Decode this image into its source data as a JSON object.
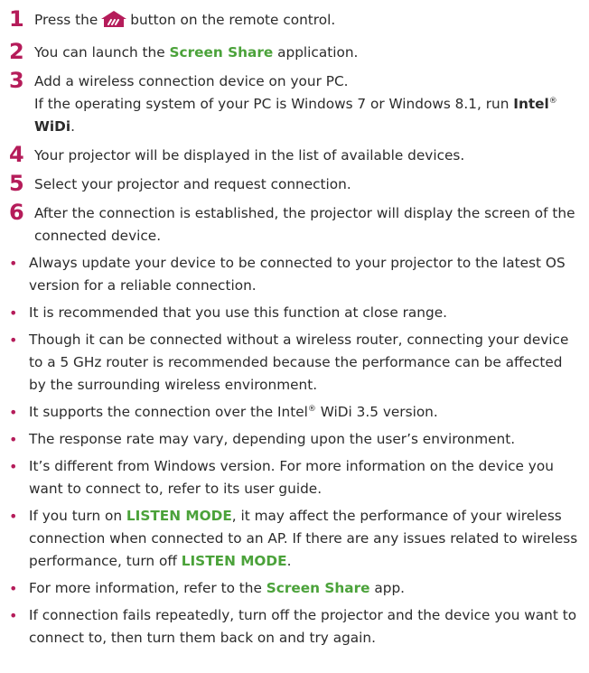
{
  "steps": [
    {
      "num": "1",
      "before": "Press the",
      "icon": "home-icon",
      "after": "button on the remote control."
    },
    {
      "num": "2",
      "before": "You can launch the ",
      "highlight": "Screen Share",
      "after": " application."
    },
    {
      "num": "3",
      "line1": "Add a wireless connection device on your PC.",
      "line2_before": "If the operating system of your PC is Windows 7 or Windows 8.1, run ",
      "bold1": "Intel",
      "sup": "®",
      "bold2": "WiDi",
      "line2_after": "."
    },
    {
      "num": "4",
      "text": "Your projector will be displayed in the list of available devices."
    },
    {
      "num": "5",
      "text": "Select your projector and request connection."
    },
    {
      "num": "6",
      "text": "After the connection is established, the projector will display the screen of the connected device."
    }
  ],
  "bullets": [
    {
      "text": "Always update your device to be connected to your projector to the latest OS version for a reliable connection."
    },
    {
      "text": "It is recommended that you use this function at close range."
    },
    {
      "text": "Though it can be connected without a wireless router, connecting your device to a 5 GHz router is recommended because the performance can be affected by the surrounding wireless environment."
    },
    {
      "before": "It supports the connection over the Intel",
      "sup": "®",
      "after": " WiDi 3.5 version."
    },
    {
      "text": "The response rate may vary, depending upon the user’s environment."
    },
    {
      "text": "It’s different from Windows version. For more information on the device you want to connect to, refer to its user guide."
    },
    {
      "before": "If you turn on ",
      "highlight1": "LISTEN MODE",
      "middle": ", it may affect the performance of your wireless connection when connected to an AP. If there are any issues related to wireless performance, turn off ",
      "highlight2": "LISTEN MODE",
      "after": "."
    },
    {
      "before": "For more information, refer to the ",
      "highlight": "Screen Share",
      "after": " app."
    },
    {
      "text": "If connection fails repeatedly, turn off the projector and the device you want to connect to, then turn them back on and try again."
    }
  ],
  "bullet_symbol": "•",
  "colors": {
    "step_number": "#b51c5a",
    "highlight": "#4ba23a",
    "text": "#2b2b2b"
  }
}
